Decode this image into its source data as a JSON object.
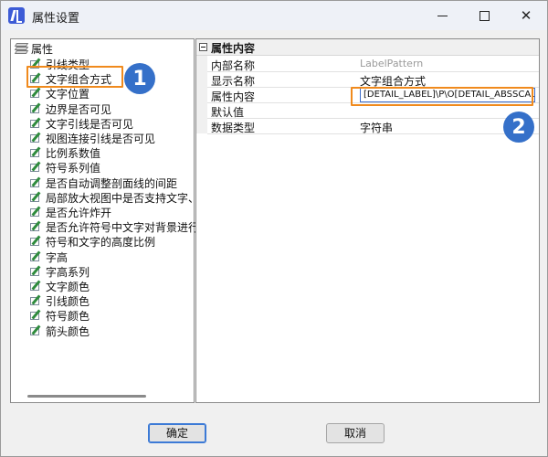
{
  "window": {
    "title": "属性设置",
    "minimize_label": "",
    "maximize_label": "",
    "close_label": "✕"
  },
  "tree": {
    "root_label": "属性",
    "items": [
      "引线类型",
      "文字组合方式",
      "文字位置",
      "边界是否可见",
      "文字引线是否可见",
      "视图连接引线是否可见",
      "比例系数值",
      "符号系列值",
      "是否自动调整剖面线的间距",
      "局部放大视图中是否支持文字、属",
      "是否允许炸开",
      "是否允许符号中文字对背景进行遮",
      "符号和文字的高度比例",
      "字高",
      "字高系列",
      "文字颜色",
      "引线颜色",
      "符号颜色",
      "箭头颜色"
    ],
    "selected_index": 1
  },
  "grid": {
    "section_title": "属性内容",
    "rows": [
      {
        "key": "内部名称",
        "value": "LabelPattern"
      },
      {
        "key": "显示名称",
        "value": "文字组合方式"
      },
      {
        "key": "属性内容",
        "value": "[DETAIL_LABEL]\\P\\O[DETAIL_ABSSCALE]"
      },
      {
        "key": "默认值",
        "value": ""
      },
      {
        "key": "数据类型",
        "value": "字符串"
      }
    ]
  },
  "markers": {
    "one": "1",
    "two": "2"
  },
  "buttons": {
    "ok": "确定",
    "cancel": "取消"
  },
  "colors": {
    "highlight": "#f08a1d",
    "marker": "#3570c9"
  }
}
